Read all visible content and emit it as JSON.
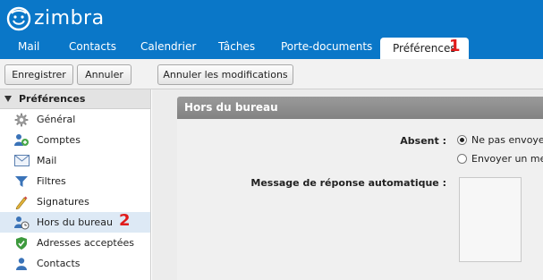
{
  "app": {
    "logo_text": "zimbra"
  },
  "tabs": [
    {
      "label": "Mail"
    },
    {
      "label": "Contacts"
    },
    {
      "label": "Calendrier"
    },
    {
      "label": "Tâches"
    },
    {
      "label": "Porte-documents"
    },
    {
      "label": "Préférences",
      "active": true
    }
  ],
  "markers": {
    "tab": "1",
    "sidebar": "2"
  },
  "toolbar": {
    "save_label": "Enregistrer",
    "cancel_label": "Annuler",
    "undo_label": "Annuler les modifications"
  },
  "sidebar": {
    "header": "Préférences",
    "items": [
      {
        "label": "Général",
        "icon": "gear-icon"
      },
      {
        "label": "Comptes",
        "icon": "accounts-icon"
      },
      {
        "label": "Mail",
        "icon": "mail-icon"
      },
      {
        "label": "Filtres",
        "icon": "filter-icon"
      },
      {
        "label": "Signatures",
        "icon": "signature-icon"
      },
      {
        "label": "Hors du bureau",
        "icon": "out-of-office-icon",
        "selected": true
      },
      {
        "label": "Adresses acceptées",
        "icon": "shield-check-icon"
      },
      {
        "label": "Contacts",
        "icon": "contact-icon"
      }
    ]
  },
  "panel": {
    "title": "Hors du bureau",
    "absent_label": "Absent :",
    "option_no_send": "Ne pas envoyer",
    "option_send": "Envoyer un mes",
    "auto_reply_label": "Message de réponse automatique :"
  },
  "colors": {
    "header_bg": "#0a77c8",
    "marker": "#e01b1b",
    "selected_item": "#dde9f5"
  }
}
